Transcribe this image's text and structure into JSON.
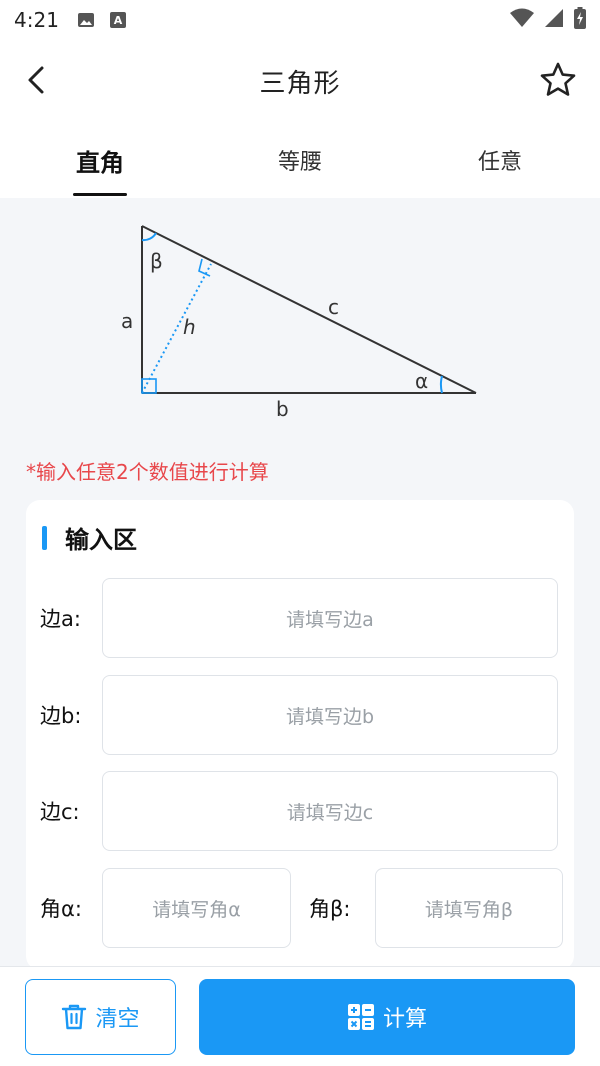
{
  "status_bar": {
    "time": "4:21",
    "icons": [
      "image-icon",
      "font-icon",
      "wifi-icon",
      "signal-icon",
      "battery-icon"
    ]
  },
  "header": {
    "title": "三角形",
    "back_icon": "chevron-left-icon",
    "favorite_icon": "star-outline-icon"
  },
  "tabs": [
    {
      "label": "直角",
      "active": true
    },
    {
      "label": "等腰",
      "active": false
    },
    {
      "label": "任意",
      "active": false
    }
  ],
  "diagram": {
    "labels": {
      "a": "a",
      "b": "b",
      "c": "c",
      "h": "h",
      "alpha": "α",
      "beta": "β"
    }
  },
  "hint": "*输入任意2个数值进行计算",
  "input_card": {
    "title": "输入区",
    "fields": [
      {
        "label": "边a:",
        "placeholder": "请填写边a"
      },
      {
        "label": "边b:",
        "placeholder": "请填写边b"
      },
      {
        "label": "边c:",
        "placeholder": "请填写边c"
      }
    ],
    "angles": [
      {
        "label": "角α:",
        "placeholder": "请填写角α"
      },
      {
        "label": "角β:",
        "placeholder": "请填写角β"
      }
    ]
  },
  "actions": {
    "clear_label": "清空",
    "calculate_label": "计算"
  },
  "colors": {
    "accent": "#1a98f5",
    "hint": "#e8474b",
    "background": "#f4f6f9"
  }
}
